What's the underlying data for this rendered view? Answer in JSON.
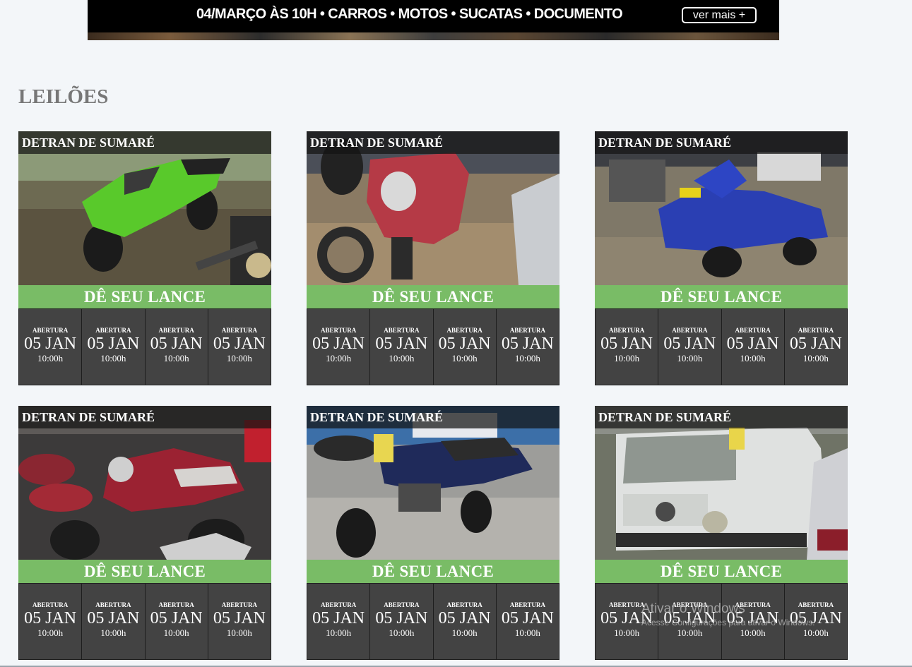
{
  "banner": {
    "text": "04/MARÇO ÀS 10H • CARROS • MOTOS • SUCATAS • DOCUMENTO",
    "button_label": "ver mais +"
  },
  "section": {
    "title": "LEILÕES"
  },
  "cards": [
    {
      "agency": "DETRAN DE SUMARÉ",
      "cta": "DÊ SEU LANCE",
      "photo": "green-sport-motorcycle",
      "dates": [
        {
          "label": "ABERTURA",
          "date": "05 JAN",
          "time": "10:00h"
        },
        {
          "label": "ABERTURA",
          "date": "05 JAN",
          "time": "10:00h"
        },
        {
          "label": "ABERTURA",
          "date": "05 JAN",
          "time": "10:00h"
        },
        {
          "label": "ABERTURA",
          "date": "05 JAN",
          "time": "10:00h"
        }
      ]
    },
    {
      "agency": "DETRAN DE SUMARÉ",
      "cta": "DÊ SEU LANCE",
      "photo": "red-street-motorcycle",
      "dates": [
        {
          "label": "ABERTURA",
          "date": "05 JAN",
          "time": "10:00h"
        },
        {
          "label": "ABERTURA",
          "date": "05 JAN",
          "time": "10:00h"
        },
        {
          "label": "ABERTURA",
          "date": "05 JAN",
          "time": "10:00h"
        },
        {
          "label": "ABERTURA",
          "date": "05 JAN",
          "time": "10:00h"
        }
      ]
    },
    {
      "agency": "DETRAN DE SUMARÉ",
      "cta": "DÊ SEU LANCE",
      "photo": "blue-scooter",
      "dates": [
        {
          "label": "ABERTURA",
          "date": "05 JAN",
          "time": "10:00h"
        },
        {
          "label": "ABERTURA",
          "date": "05 JAN",
          "time": "10:00h"
        },
        {
          "label": "ABERTURA",
          "date": "05 JAN",
          "time": "10:00h"
        },
        {
          "label": "ABERTURA",
          "date": "05 JAN",
          "time": "10:00h"
        }
      ]
    },
    {
      "agency": "DETRAN DE SUMARÉ",
      "cta": "DÊ SEU LANCE",
      "photo": "red-motorcycles-pile",
      "dates": [
        {
          "label": "ABERTURA",
          "date": "05 JAN",
          "time": "10:00h"
        },
        {
          "label": "ABERTURA",
          "date": "05 JAN",
          "time": "10:00h"
        },
        {
          "label": "ABERTURA",
          "date": "05 JAN",
          "time": "10:00h"
        },
        {
          "label": "ABERTURA",
          "date": "05 JAN",
          "time": "10:00h"
        }
      ]
    },
    {
      "agency": "DETRAN DE SUMARÉ",
      "cta": "DÊ SEU LANCE",
      "photo": "navy-trail-motorcycle",
      "dates": [
        {
          "label": "ABERTURA",
          "date": "05 JAN",
          "time": "10:00h"
        },
        {
          "label": "ABERTURA",
          "date": "05 JAN",
          "time": "10:00h"
        },
        {
          "label": "ABERTURA",
          "date": "05 JAN",
          "time": "10:00h"
        },
        {
          "label": "ABERTURA",
          "date": "05 JAN",
          "time": "10:00h"
        }
      ]
    },
    {
      "agency": "DETRAN DE SUMARÉ",
      "cta": "DÊ SEU LANCE",
      "photo": "white-vw-van",
      "dates": [
        {
          "label": "ABERTURA",
          "date": "05 JAN",
          "time": "10:00h"
        },
        {
          "label": "ABERTURA",
          "date": "05 JAN",
          "time": "10:00h"
        },
        {
          "label": "ABERTURA",
          "date": "05 JAN",
          "time": "10:00h"
        },
        {
          "label": "ABERTURA",
          "date": "05 JAN",
          "time": "10:00h"
        }
      ]
    }
  ],
  "windows_watermark": {
    "title": "Ativar o Windows",
    "subtitle": "Acesse Configurações para ativar o Windows."
  },
  "colors": {
    "background": "#f3f6f9",
    "cta_green": "#79bc66",
    "date_bar": "#434343",
    "title_gray": "#777777"
  }
}
